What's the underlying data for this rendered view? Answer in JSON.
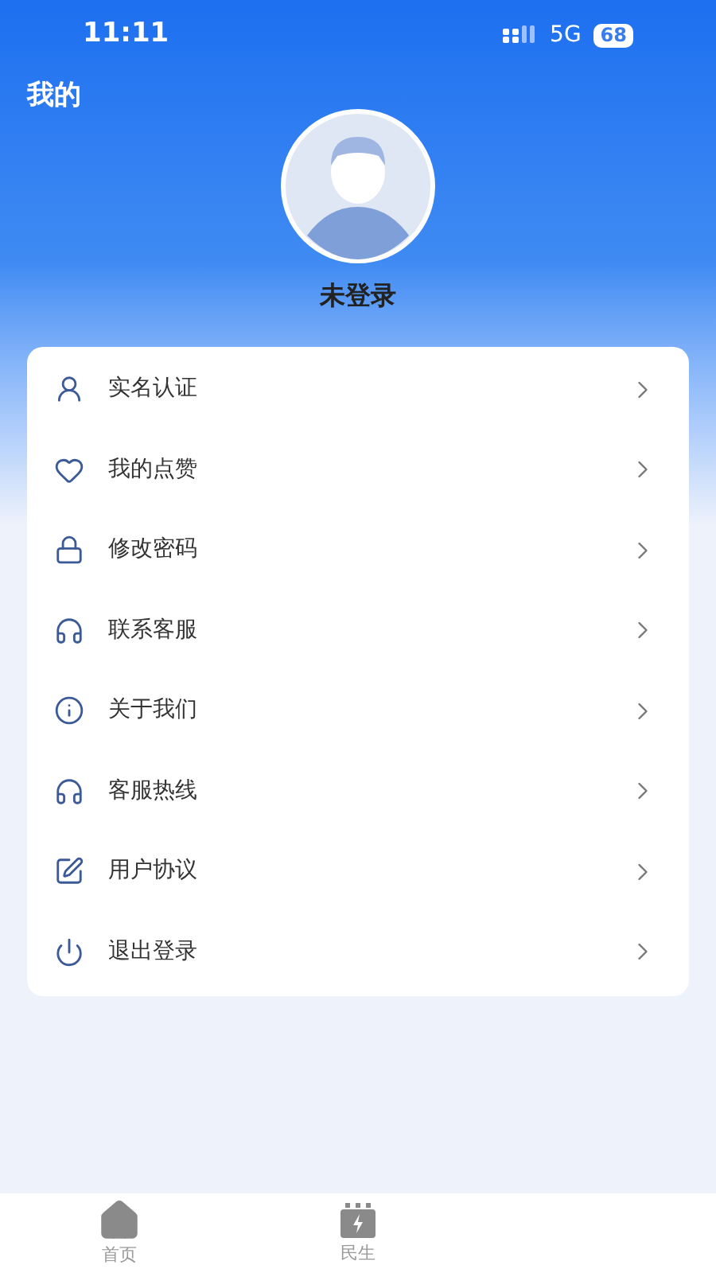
{
  "status_bar": {
    "time": "11:11",
    "network": "5G",
    "battery": "68"
  },
  "header": {
    "title": "我的",
    "username": "未登录"
  },
  "menu": [
    {
      "kind": "verify",
      "label": "实名认证"
    },
    {
      "kind": "like",
      "label": "我的点赞"
    },
    {
      "kind": "password",
      "label": "修改密码"
    },
    {
      "kind": "support",
      "label": "联系客服"
    },
    {
      "kind": "about",
      "label": "关于我们"
    },
    {
      "kind": "support",
      "label": "客服热线"
    },
    {
      "kind": "agreement",
      "label": "用户协议"
    },
    {
      "kind": "logout",
      "label": "退出登录"
    }
  ],
  "bottom_nav": [
    {
      "kind": "home",
      "label": "首页"
    },
    {
      "kind": "livelihood",
      "label": "民生"
    }
  ]
}
